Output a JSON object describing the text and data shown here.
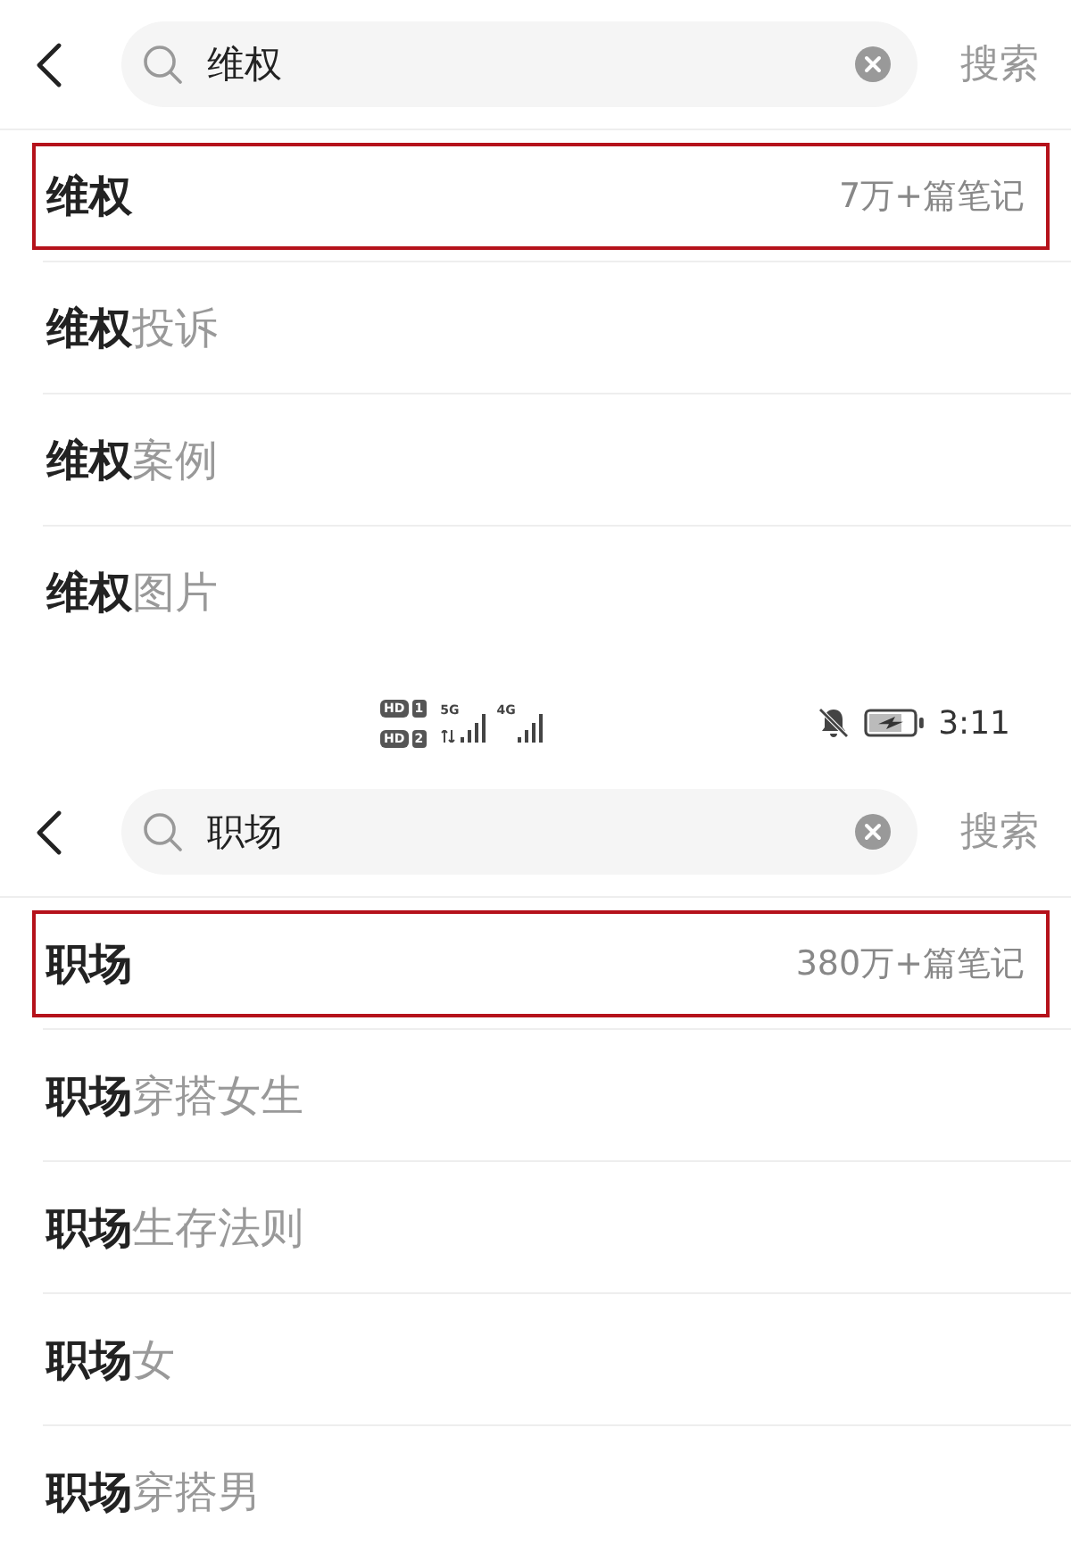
{
  "screens": [
    {
      "search": {
        "value": "维权",
        "button": "搜索"
      },
      "suggestions": [
        {
          "kind": "exact",
          "text": "维权",
          "count": "7万+篇笔记",
          "highlighted": true
        },
        {
          "kind": "completion",
          "text": "**维权**投诉",
          "highlighted": false
        },
        {
          "kind": "completion",
          "text": "**维权**案例",
          "highlighted": false
        },
        {
          "kind": "completion",
          "text": "**维权**图片",
          "highlighted": false
        }
      ]
    },
    {
      "status_bar": {
        "sims": [
          {
            "badge": "HD",
            "slot": "1"
          },
          {
            "badge": "HD",
            "slot": "2"
          }
        ],
        "networks": [
          {
            "type": "5G",
            "data_active": true
          },
          {
            "type": "4G",
            "data_active": false
          }
        ],
        "time": "3:11"
      },
      "search": {
        "value": "职场",
        "button": "搜索"
      },
      "suggestions": [
        {
          "kind": "exact",
          "text": "职场",
          "count": "380万+篇笔记",
          "highlighted": true
        },
        {
          "kind": "completion",
          "text": "**职场**穿搭女生",
          "highlighted": false
        },
        {
          "kind": "completion",
          "text": "**职场**生存法则",
          "highlighted": false
        },
        {
          "kind": "completion",
          "text": "**职场**女",
          "highlighted": false
        },
        {
          "kind": "completion",
          "text": "**职场**穿搭男",
          "highlighted": false
        }
      ]
    }
  ]
}
